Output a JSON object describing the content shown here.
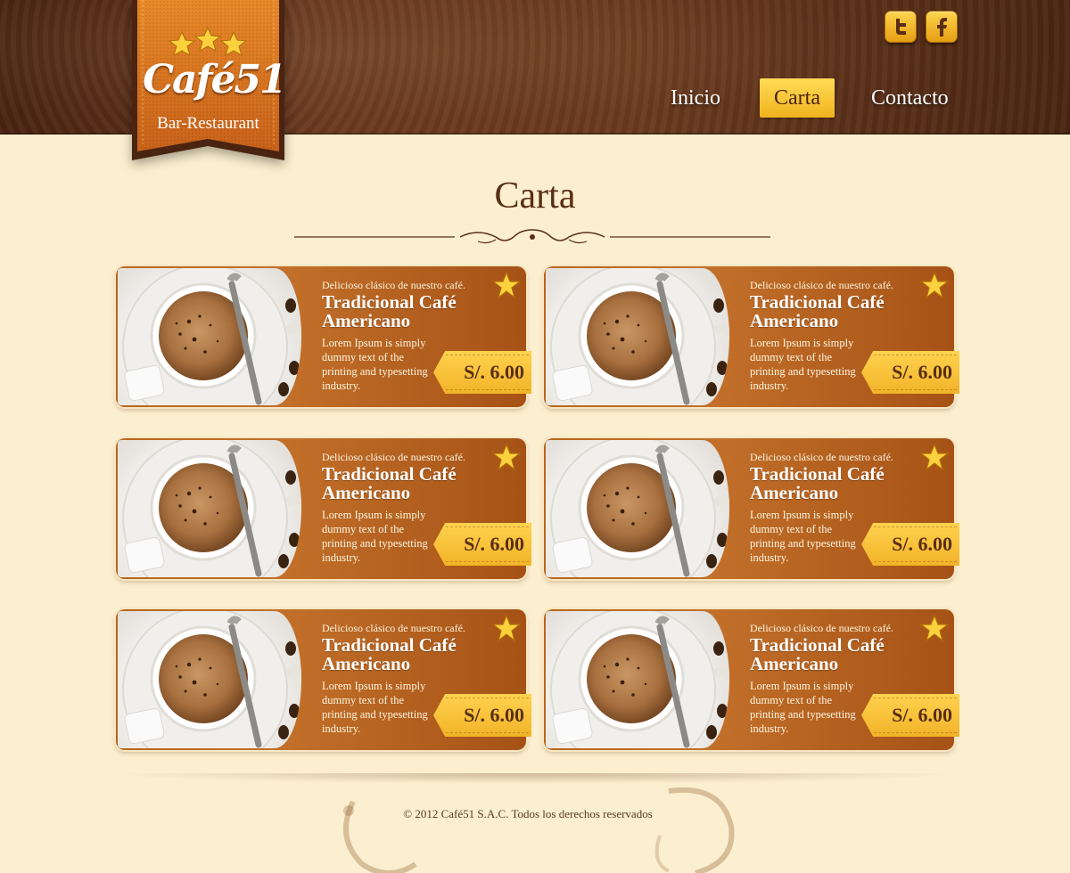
{
  "header": {
    "logo": {
      "name": "Café51",
      "subtitle": "Bar-Restaurant"
    },
    "social": [
      {
        "icon": "twitter-icon"
      },
      {
        "icon": "facebook-icon"
      }
    ],
    "nav": [
      {
        "label": "Inicio",
        "active": false
      },
      {
        "label": "Carta",
        "active": true
      },
      {
        "label": "Contacto",
        "active": false
      }
    ]
  },
  "main": {
    "title": "Carta",
    "items": [
      {
        "tagline": "Delicioso clásico de nuestro café.",
        "title": "Tradicional Café Americano",
        "description": "Lorem Ipsum is simply dummy text of the printing and typesetting industry.",
        "price": "S/. 6.00"
      },
      {
        "tagline": "Delicioso clásico de nuestro café.",
        "title": "Tradicional Café Americano",
        "description": "Lorem Ipsum is simply dummy text of the printing and typesetting industry.",
        "price": "S/. 6.00"
      },
      {
        "tagline": "Delicioso clásico de nuestro café.",
        "title": "Tradicional Café Americano",
        "description": "Lorem Ipsum is simply dummy text of the printing and typesetting industry.",
        "price": "S/. 6.00"
      },
      {
        "tagline": "Delicioso clásico de nuestro café.",
        "title": "Tradicional Café Americano",
        "description": "Lorem Ipsum is simply dummy text of the printing and typesetting industry.",
        "price": "S/. 6.00"
      },
      {
        "tagline": "Delicioso clásico de nuestro café.",
        "title": "Tradicional Café Americano",
        "description": "Lorem Ipsum is simply dummy text of the printing and typesetting industry.",
        "price": "S/. 6.00"
      },
      {
        "tagline": "Delicioso clásico de nuestro café.",
        "title": "Tradicional Café Americano",
        "description": "Lorem Ipsum is simply dummy text of the printing and typesetting industry.",
        "price": "S/. 6.00"
      }
    ]
  },
  "footer": {
    "copyright": "© 2012 Café51 S.A.C. Todos los derechos reservados"
  },
  "colors": {
    "header_brown": "#5a2e17",
    "accent_orange": "#c2702a",
    "highlight_yellow": "#f6c33a",
    "page_bg": "#fbefd0",
    "title_text": "#5a2e14"
  }
}
